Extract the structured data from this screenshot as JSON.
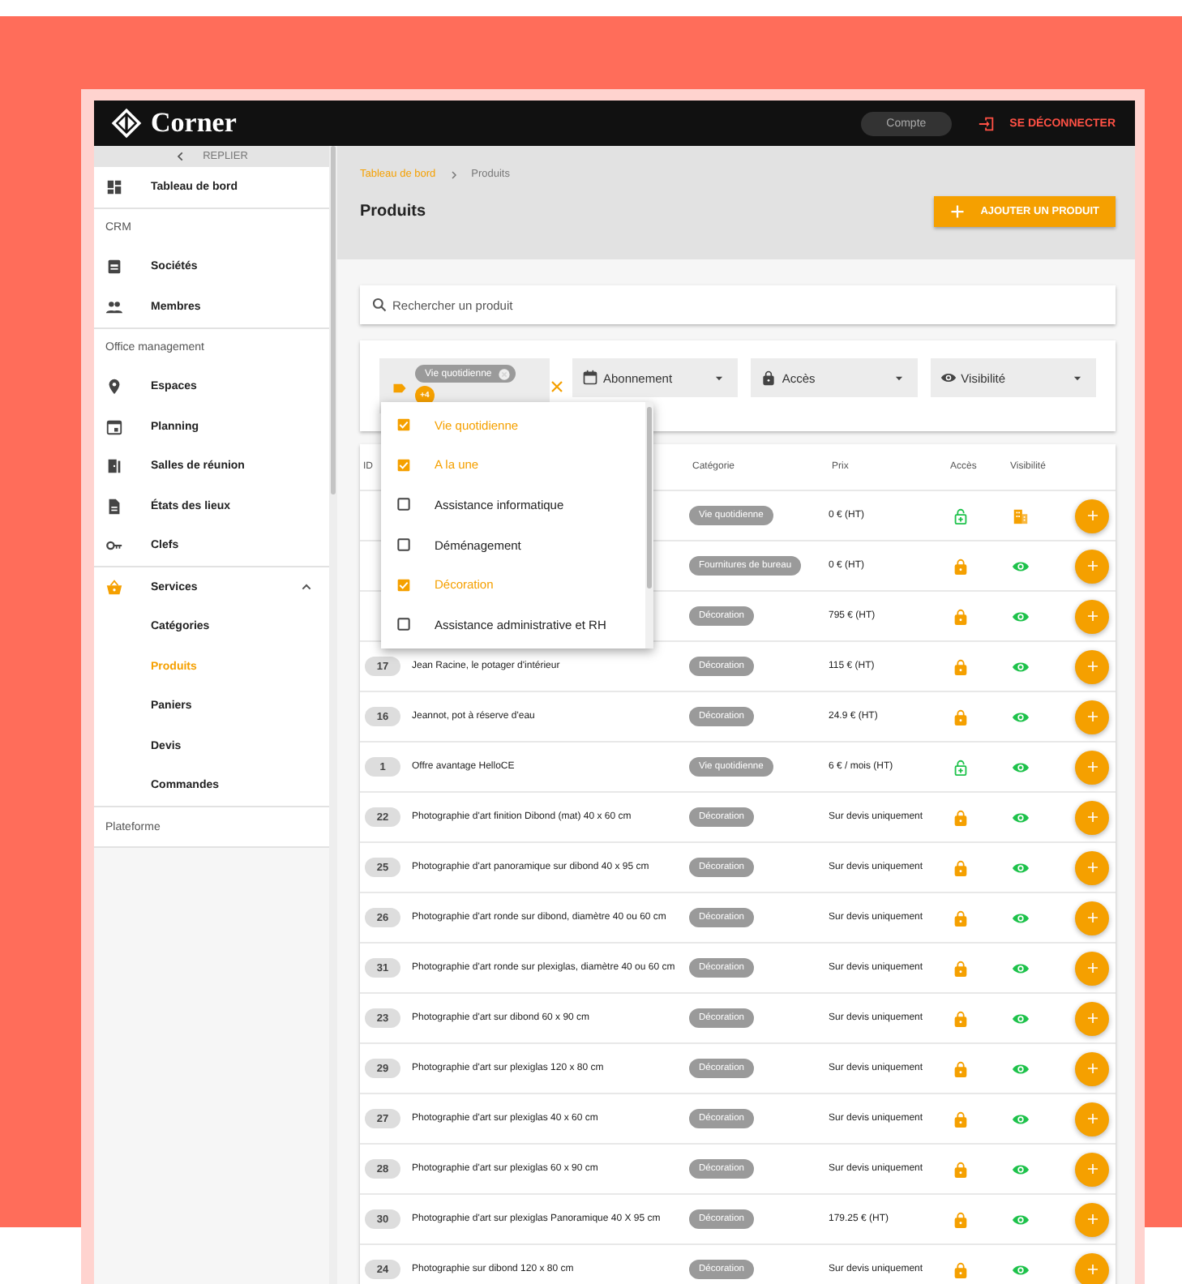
{
  "topbar": {
    "brand": "Corner",
    "account_button": "Compte",
    "logout_button": "SE DÉCONNECTER"
  },
  "sidebar": {
    "collapse_label": "REPLIER",
    "sections": [
      {
        "items": [
          {
            "label": "Tableau de bord",
            "selected": false
          }
        ]
      },
      {
        "title": "CRM",
        "items": [
          {
            "label": "Sociétés",
            "selected": false
          },
          {
            "label": "Membres",
            "selected": false
          }
        ]
      },
      {
        "title": "Office management",
        "items": [
          {
            "label": "Espaces",
            "selected": false
          },
          {
            "label": "Planning",
            "selected": false
          },
          {
            "label": "Salles de réunion",
            "selected": false
          },
          {
            "label": "États des lieux",
            "selected": false
          },
          {
            "label": "Clefs",
            "selected": false
          }
        ]
      },
      {
        "items": [
          {
            "label": "Services",
            "selected": false,
            "expanded": true,
            "children": [
              {
                "label": "Catégories",
                "selected": false
              },
              {
                "label": "Produits",
                "selected": true
              },
              {
                "label": "Paniers",
                "selected": false
              },
              {
                "label": "Devis",
                "selected": false
              },
              {
                "label": "Commandes",
                "selected": false
              }
            ]
          }
        ]
      },
      {
        "title": "Plateforme"
      }
    ]
  },
  "breadcrumb": [
    {
      "label": "Tableau de bord",
      "kind": "link"
    },
    {
      "label": "Produits",
      "kind": "current"
    }
  ],
  "page_title": "Produits",
  "add_button": "AJOUTER UN PRODUIT",
  "search": {
    "placeholder": "Rechercher un produit"
  },
  "filters": {
    "tag_filter": {
      "chips": [
        {
          "label": "Vie quotidienne"
        }
      ],
      "more": "+4"
    },
    "selects": [
      {
        "label": "Abonnement",
        "kind": "calendar"
      },
      {
        "label": "Accès",
        "kind": "lock"
      },
      {
        "label": "Visibilité",
        "kind": "eye"
      }
    ]
  },
  "tag_menu": [
    {
      "label": "Vie quotidienne",
      "checked": true
    },
    {
      "label": "A la une",
      "checked": true
    },
    {
      "label": "Assistance informatique",
      "checked": false
    },
    {
      "label": "Déménagement",
      "checked": false
    },
    {
      "label": "Décoration",
      "checked": true
    },
    {
      "label": "Assistance administrative et RH",
      "checked": false
    }
  ],
  "table": {
    "columns": {
      "id": "ID",
      "category": "Catégorie",
      "price": "Prix",
      "access": "Accès",
      "visibility": "Visibilité"
    },
    "rows": [
      {
        "category": "Vie quotidienne",
        "price": "0 € (HT)",
        "locked": false,
        "company_only": true
      },
      {
        "category": "Fournitures de bureau",
        "price": "0 € (HT)",
        "locked": true,
        "company_only": false
      },
      {
        "category": "Décoration",
        "price": "795 € (HT)",
        "locked": true,
        "company_only": false
      },
      {
        "id": "17",
        "name": "Jean Racine, le potager d'intérieur",
        "category": "Décoration",
        "price": "115 € (HT)",
        "locked": true,
        "company_only": false
      },
      {
        "id": "16",
        "name": "Jeannot, pot à réserve d'eau",
        "category": "Décoration",
        "price": "24.9 € (HT)",
        "locked": true,
        "company_only": false
      },
      {
        "id": "1",
        "name": "Offre avantage HelloCE",
        "category": "Vie quotidienne",
        "price": "6 € / mois (HT)",
        "locked": false,
        "company_only": false
      },
      {
        "id": "22",
        "name": "Photographie d'art finition Dibond (mat) 40 x 60 cm",
        "category": "Décoration",
        "price": "Sur devis uniquement",
        "locked": true,
        "company_only": false
      },
      {
        "id": "25",
        "name": "Photographie d'art panoramique sur dibond 40 x 95 cm",
        "category": "Décoration",
        "price": "Sur devis uniquement",
        "locked": true,
        "company_only": false
      },
      {
        "id": "26",
        "name": "Photographie d'art ronde sur dibond, diamètre 40 ou 60 cm",
        "category": "Décoration",
        "price": "Sur devis uniquement",
        "locked": true,
        "company_only": false
      },
      {
        "id": "31",
        "name": "Photographie d'art ronde sur plexiglas, diamètre 40 ou 60 cm",
        "category": "Décoration",
        "price": "Sur devis uniquement",
        "locked": true,
        "company_only": false
      },
      {
        "id": "23",
        "name": "Photographie d'art sur dibond 60 x 90 cm",
        "category": "Décoration",
        "price": "Sur devis uniquement",
        "locked": true,
        "company_only": false
      },
      {
        "id": "29",
        "name": "Photographie d'art sur plexiglas 120 x 80 cm",
        "category": "Décoration",
        "price": "Sur devis uniquement",
        "locked": true,
        "company_only": false
      },
      {
        "id": "27",
        "name": "Photographie d'art sur plexiglas 40 x 60 cm",
        "category": "Décoration",
        "price": "Sur devis uniquement",
        "locked": true,
        "company_only": false
      },
      {
        "id": "28",
        "name": "Photographie d'art sur plexiglas 60 x 90 cm",
        "category": "Décoration",
        "price": "Sur devis uniquement",
        "locked": true,
        "company_only": false
      },
      {
        "id": "30",
        "name": "Photographie d'art sur plexiglas Panoramique 40 X 95 cm",
        "category": "Décoration",
        "price": "179.25 € (HT)",
        "locked": true,
        "company_only": false
      },
      {
        "id": "24",
        "name": "Photographie sur dibond 120 x 80 cm",
        "category": "Décoration",
        "price": "Sur devis uniquement",
        "locked": true,
        "company_only": false
      }
    ]
  }
}
